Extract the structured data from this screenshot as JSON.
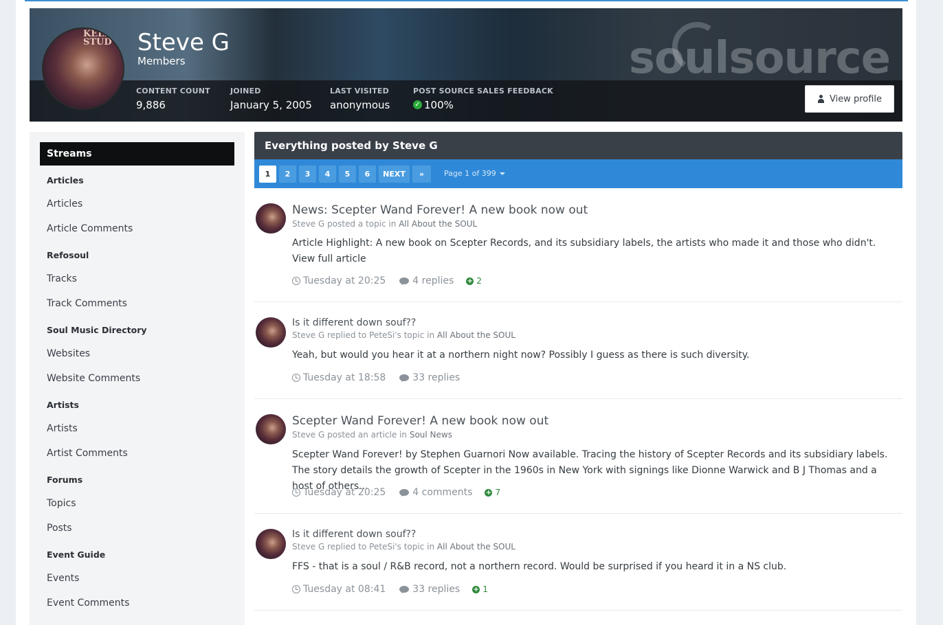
{
  "profile": {
    "name": "Steve G",
    "group": "Members",
    "stats": [
      {
        "label": "CONTENT COUNT",
        "value": "9,886"
      },
      {
        "label": "JOINED",
        "value": "January 5, 2005"
      },
      {
        "label": "LAST VISITED",
        "value": "anonymous"
      },
      {
        "label": "POST SOURCE SALES FEEDBACK",
        "value": "100%"
      }
    ],
    "view_profile_label": "View profile",
    "brand": "soulsource"
  },
  "sidebar": {
    "active": "Streams",
    "sections": [
      {
        "heading": "Articles",
        "items": [
          "Articles",
          "Article Comments"
        ]
      },
      {
        "heading": "Refosoul",
        "items": [
          "Tracks",
          "Track Comments"
        ]
      },
      {
        "heading": "Soul Music Directory",
        "items": [
          "Websites",
          "Website Comments"
        ]
      },
      {
        "heading": "Artists",
        "items": [
          "Artists",
          "Artist Comments"
        ]
      },
      {
        "heading": "Forums",
        "items": [
          "Topics",
          "Posts"
        ]
      },
      {
        "heading": "Event Guide",
        "items": [
          "Events",
          "Event Comments"
        ]
      }
    ]
  },
  "main": {
    "title": "Everything posted by Steve G",
    "pages": [
      "1",
      "2",
      "3",
      "4",
      "5",
      "6"
    ],
    "next_label": "NEXT",
    "last_label": "»",
    "page_info": "Page 1 of 399",
    "entries": [
      {
        "title": "News: Scepter Wand Forever! A new book now out",
        "meta_pre": "Steve G posted a topic in",
        "forum": "All About the SOUL",
        "body": "Article Highlight: A new book on Scepter Records, and its subsidiary labels, the artists who made it and those who didn't. View full article",
        "time": "Tuesday at 20:25",
        "count": "4 replies",
        "rep": "2"
      },
      {
        "title": "Is it different down souf??",
        "meta_pre": "Steve G replied to PeteSi's topic in",
        "forum": "All About the SOUL",
        "body": "Yeah, but would you hear it at a northern night now? Possibly I guess as there is such diversity.",
        "time": "Tuesday at 18:58",
        "count": "33 replies",
        "rep": ""
      },
      {
        "title": "Scepter Wand Forever! A new book now out",
        "meta_pre": "Steve G posted an article in",
        "forum": "Soul News",
        "body": "Scepter Wand Forever! by Stephen Guarnori Now available. Tracing the history of Scepter Records and its subsidiary labels. The story details the growth of Scepter in the 1960s in New York with signings like Dionne Warwick and B J Thomas and a host of others...",
        "time": "Tuesday at 20:25",
        "count": "4 comments",
        "rep": "7"
      },
      {
        "title": "Is it different down souf??",
        "meta_pre": "Steve G replied to PeteSi's topic in",
        "forum": "All About the SOUL",
        "body": "FFS - that is a soul / R&B record, not a northern record. Would be surprised if you heard it in a NS club.",
        "time": "Tuesday at 08:41",
        "count": "33 replies",
        "rep": "1"
      }
    ]
  },
  "colors": {
    "accent_blue": "#2f89d8",
    "header_dark": "#3a4048",
    "rep_green": "#2f8a3c"
  }
}
